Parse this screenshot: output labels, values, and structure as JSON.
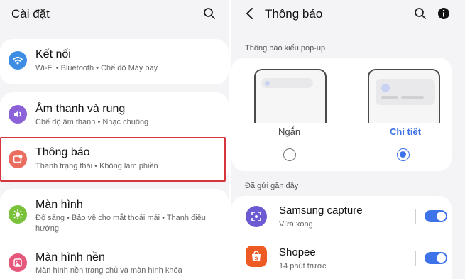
{
  "left": {
    "header": {
      "title": "Cài đặt",
      "search_icon": "search-icon"
    },
    "items": [
      {
        "label": "Kết nối",
        "sub": "Wi-Fi  •  Bluetooth  •  Chế độ Máy bay",
        "icon": "wifi-icon",
        "color": "#3d8de3"
      },
      {
        "label": "Âm thanh và rung",
        "sub": "Chế độ âm thanh  •  Nhạc chuông",
        "icon": "volume-icon",
        "color": "#8b62d8"
      },
      {
        "label": "Thông báo",
        "sub": "Thanh trạng thái  •  Không làm phiền",
        "icon": "notification-icon",
        "color": "#ea6d5f"
      },
      {
        "label": "Màn hình",
        "sub": "Độ sáng  •  Bảo vệ cho mắt thoải mái  •  Thanh điều",
        "sub2": "hướng",
        "icon": "brightness-icon",
        "color": "#7ac23b"
      },
      {
        "label": "Màn hình nền",
        "sub": "Màn hình nền trang chủ và màn hình khóa",
        "icon": "wallpaper-icon",
        "color": "#e6577c"
      }
    ]
  },
  "right": {
    "header": {
      "title": "Thông báo",
      "back_icon": "back-arrow-icon",
      "search_icon": "search-icon",
      "info_icon": "info-icon"
    },
    "popup": {
      "section_label": "Thông báo kiểu pop-up",
      "options": [
        {
          "label": "Ngắn",
          "selected": false
        },
        {
          "label": "Chi tiết",
          "selected": true
        }
      ]
    },
    "recent": {
      "section_label": "Đã gửi gần đây",
      "apps": [
        {
          "name": "Samsung capture",
          "time": "Vừa xong",
          "enabled": true,
          "icon": "samsung-capture-icon",
          "color": "#6b5ad1"
        },
        {
          "name": "Shopee",
          "time": "14 phút trước",
          "enabled": true,
          "icon": "shopee-icon",
          "color": "#ee5a24"
        }
      ]
    },
    "accent_color": "#3e72e8"
  },
  "highlight_color": "#d5353d"
}
